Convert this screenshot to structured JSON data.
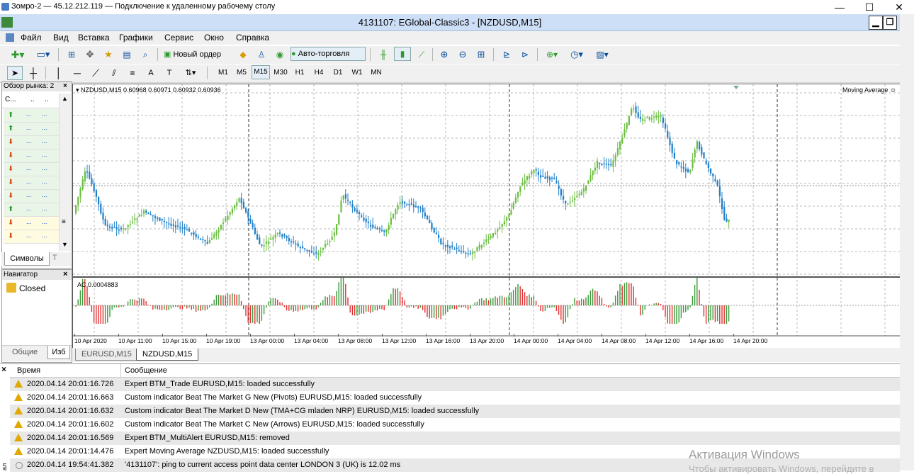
{
  "rdp": {
    "title": "Зомро-2 — 45.12.212.119 — Подключение к удаленному рабочему столу",
    "minimize": "—",
    "maximize": "☐",
    "close": "✕"
  },
  "terminal_window": {
    "title": "4131107: EGlobal-Classic3 - [NZDUSD,M15]",
    "restore": "❐"
  },
  "menu": [
    "Файл",
    "Вид",
    "Вставка",
    "Графики",
    "Сервис",
    "Окно",
    "Справка"
  ],
  "toolbar": {
    "new_order": "Новый ордер",
    "auto_trading": "Авто-торговля",
    "timeframes": [
      "M1",
      "M5",
      "M15",
      "M30",
      "H1",
      "H4",
      "D1",
      "W1",
      "MN"
    ],
    "active_timeframe": "M15"
  },
  "market_watch": {
    "title": "Обзор рынка: 2",
    "close": "×",
    "col_headers": [
      "С...",
      "..",
      ".."
    ],
    "rows": [
      {
        "dir": "up",
        "bid": "...",
        "ask": "..."
      },
      {
        "dir": "up",
        "bid": "...",
        "ask": "..."
      },
      {
        "dir": "down",
        "bid": "...",
        "ask": "..."
      },
      {
        "dir": "down",
        "bid": "...",
        "ask": "..."
      },
      {
        "dir": "down",
        "bid": "...",
        "ask": "..."
      },
      {
        "dir": "down",
        "bid": "...",
        "ask": "..."
      },
      {
        "dir": "down",
        "bid": "...",
        "ask": "..."
      },
      {
        "dir": "up",
        "bid": "...",
        "ask": "..."
      },
      {
        "dir": "down",
        "bid": "...",
        "ask": "..."
      },
      {
        "dir": "down",
        "bid": "...",
        "ask": "..."
      }
    ],
    "tabs": [
      "Символы",
      "Т"
    ]
  },
  "navigator": {
    "title": "Навигатор",
    "close": "×",
    "items": [
      "Closed"
    ],
    "tabs": [
      "Общие",
      "Изб"
    ]
  },
  "chart": {
    "symbol_info": "NZDUSD,M15  0.60968 0.60971 0.60932 0.60936",
    "indicator_label": "Moving Average",
    "sub_label": "AC 0.0004883",
    "time_labels": [
      "10 Apr 2020",
      "10 Apr 11:00",
      "10 Apr 15:00",
      "10 Apr 19:00",
      "13 Apr 00:00",
      "13 Apr 04:00",
      "13 Apr 08:00",
      "13 Apr 12:00",
      "13 Apr 16:00",
      "13 Apr 20:00",
      "14 Apr 00:00",
      "14 Apr 04:00",
      "14 Apr 08:00",
      "14 Apr 12:00",
      "14 Apr 16:00",
      "14 Apr 20:00"
    ],
    "colors": {
      "bull": "#6abf40",
      "bear": "#1f7fc9",
      "ac_up": "#3a9a3a",
      "ac_down": "#e03030"
    }
  },
  "chart_tabs": [
    "EURUSD,M15",
    "NZDUSD,M15"
  ],
  "active_chart_tab": "NZDUSD,M15",
  "terminal": {
    "headers": [
      "Время",
      "Сообщение"
    ],
    "rows": [
      {
        "time": "2020.04.14 20:01:16.726",
        "msg": "Expert BTM_Trade EURUSD,M15: loaded successfully",
        "type": "warn"
      },
      {
        "time": "2020.04.14 20:01:16.663",
        "msg": "Custom indicator Beat The Market G New (Pivots) EURUSD,M15: loaded successfully",
        "type": "warn"
      },
      {
        "time": "2020.04.14 20:01:16.632",
        "msg": "Custom indicator Beat The Market D New (TMA+CG mladen NRP) EURUSD,M15: loaded successfully",
        "type": "warn"
      },
      {
        "time": "2020.04.14 20:01:16.602",
        "msg": "Custom indicator Beat The Market C New (Arrows) EURUSD,M15: loaded successfully",
        "type": "warn"
      },
      {
        "time": "2020.04.14 20:01:16.569",
        "msg": "Expert BTM_MultiAlert EURUSD,M15: removed",
        "type": "warn"
      },
      {
        "time": "2020.04.14 20:01:14.476",
        "msg": "Expert Moving Average NZDUSD,M15: loaded successfully",
        "type": "warn"
      },
      {
        "time": "2020.04.14 19:54:41.382",
        "msg": "'4131107': ping to current access point data center LONDON 3 (UK) is 12.02 ms",
        "type": "info"
      }
    ],
    "close": "×",
    "side_label": "ал"
  },
  "watermark": {
    "line1": "Активация Windows",
    "line2": "Чтобы активировать Windows, перейдите в"
  }
}
